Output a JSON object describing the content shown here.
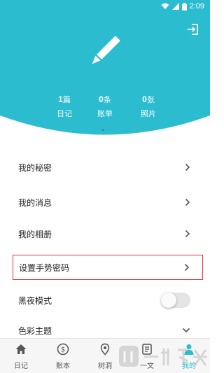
{
  "status_bar": {
    "time": "2:09"
  },
  "header": {
    "stats": [
      {
        "value": "1",
        "unit": "篇",
        "label": "日记"
      },
      {
        "value": "0",
        "unit": "条",
        "label": "账单"
      },
      {
        "value": "0",
        "unit": "张",
        "label": "照片"
      }
    ]
  },
  "menu": {
    "items": [
      {
        "label": "我的秘密"
      },
      {
        "label": "我的消息"
      },
      {
        "label": "我的相册"
      },
      {
        "label": "设置手势密码"
      },
      {
        "label": "黑夜模式"
      },
      {
        "label": "色彩主题"
      }
    ],
    "dark_mode_on": false
  },
  "bottom_nav": {
    "items": [
      {
        "label": "日记"
      },
      {
        "label": "账本"
      },
      {
        "label": "树洞"
      },
      {
        "label": "一文"
      },
      {
        "label": "我的"
      }
    ],
    "active_index": 4
  },
  "colors": {
    "accent": "#2bbcd0",
    "highlight_border": "#e0343a"
  }
}
